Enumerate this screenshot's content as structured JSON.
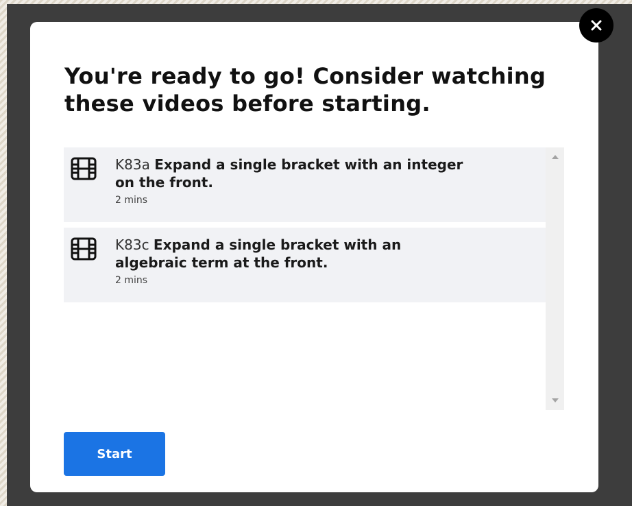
{
  "modal": {
    "heading": "You're ready to go! Consider watching these videos before starting.",
    "close_icon": "close-icon",
    "videos": [
      {
        "code": "K83a",
        "title": "Expand a single bracket with an integer on the front.",
        "duration": "2 mins",
        "icon": "film-icon"
      },
      {
        "code": "K83c",
        "title": "Expand a single bracket with an algebraic term at the front.",
        "duration": "2 mins",
        "icon": "film-icon"
      }
    ],
    "start_label": "Start"
  },
  "colors": {
    "overlay": "#3d3d3d",
    "modal_bg": "#ffffff",
    "item_bg": "#f1f2f5",
    "primary_button": "#1b74e4",
    "close_button": "#000000"
  }
}
